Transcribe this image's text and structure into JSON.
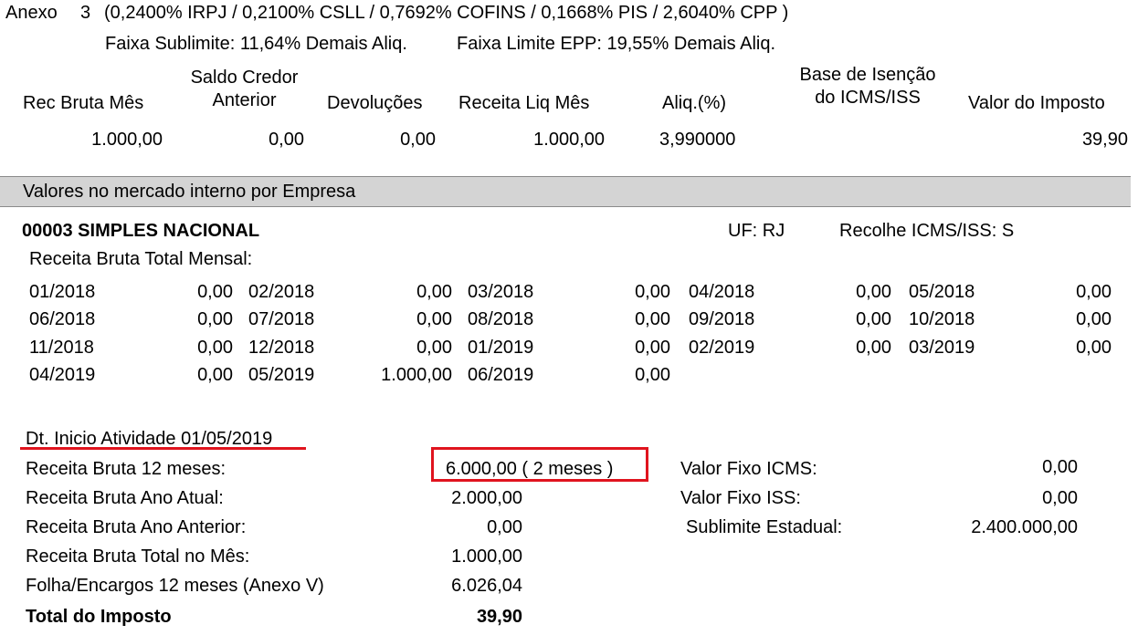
{
  "header": {
    "anexo_label": "Anexo",
    "anexo_num": "3",
    "rates": "(0,2400% IRPJ  / 0,2100% CSLL / 0,7692% COFINS / 0,1668% PIS  / 2,6040% CPP )",
    "faixa_sublimite": "Faixa Sublimite: 11,64% Demais Aliq.",
    "faixa_limite": "Faixa Limite EPP: 19,55% Demais Aliq."
  },
  "summary": {
    "columns": {
      "rec_bruta_mes": "Rec Bruta Mês",
      "saldo_credor_1": "Saldo Credor",
      "saldo_credor_2": "Anterior",
      "devolucoes": "Devoluções",
      "receita_liq_mes": "Receita Liq Mês",
      "aliq": "Aliq.(%)",
      "base_isencao_1": "Base de Isenção",
      "base_isencao_2": "do ICMS/ISS",
      "valor_imposto": "Valor do Imposto"
    },
    "values": {
      "rec_bruta_mes": "1.000,00",
      "saldo_credor": "0,00",
      "devolucoes": "0,00",
      "receita_liq_mes": "1.000,00",
      "aliq": "3,990000",
      "valor_imposto": "39,90"
    }
  },
  "section_title": "Valores no mercado interno por Empresa",
  "company": {
    "name": "00003  SIMPLES NACIONAL",
    "uf": "UF:  RJ",
    "recolhe": "Recolhe ICMS/ISS: S",
    "receita_total_label": "Receita Bruta Total Mensal:"
  },
  "monthly": [
    [
      [
        "01/2018",
        "0,00"
      ],
      [
        "02/2018",
        "0,00"
      ],
      [
        "03/2018",
        "0,00"
      ],
      [
        "04/2018",
        "0,00"
      ],
      [
        "05/2018",
        "0,00"
      ]
    ],
    [
      [
        "06/2018",
        "0,00"
      ],
      [
        "07/2018",
        "0,00"
      ],
      [
        "08/2018",
        "0,00"
      ],
      [
        "09/2018",
        "0,00"
      ],
      [
        "10/2018",
        "0,00"
      ]
    ],
    [
      [
        "11/2018",
        "0,00"
      ],
      [
        "12/2018",
        "0,00"
      ],
      [
        "01/2019",
        "0,00"
      ],
      [
        "02/2019",
        "0,00"
      ],
      [
        "03/2019",
        "0,00"
      ]
    ],
    [
      [
        "04/2019",
        "0,00"
      ],
      [
        "05/2019",
        "1.000,00"
      ],
      [
        "06/2019",
        "0,00"
      ]
    ]
  ],
  "details": {
    "dt_inicio": "Dt. Inicio Atividade  01/05/2019",
    "rows": [
      {
        "label": "Receita Bruta 12 meses:",
        "value": "6.000,00 (  2   meses )"
      },
      {
        "label": "Receita Bruta Ano Atual:",
        "value": "2.000,00"
      },
      {
        "label": "Receita Bruta Ano Anterior:",
        "value": "0,00"
      },
      {
        "label": "Receita Bruta Total no Mês:",
        "value": "1.000,00"
      },
      {
        "label": "Folha/Encargos 12 meses (Anexo V)",
        "value": "6.026,04"
      },
      {
        "label": "Total do Imposto",
        "value": "39,90"
      }
    ],
    "right_rows": [
      {
        "label": "Valor Fixo ICMS:",
        "value": "0,00"
      },
      {
        "label": "Valor Fixo ISS:",
        "value": "0,00"
      },
      {
        "label": "Sublimite Estadual:",
        "value": "2.400.000,00"
      }
    ]
  },
  "colors": {
    "highlight": "#e0141e",
    "section_bar": "#d4d4d4"
  }
}
